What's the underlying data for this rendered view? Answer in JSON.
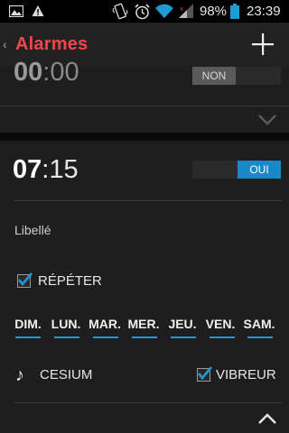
{
  "status_bar": {
    "battery_percent": "98%",
    "time": "23:39",
    "icons": [
      "image-icon",
      "warning-icon",
      "vibrate-icon",
      "alarm-clock-icon",
      "wifi-icon",
      "cell-signal-icon",
      "battery-icon"
    ]
  },
  "action_bar": {
    "title": "Alarmes",
    "add_icon": "plus-icon",
    "title_color": "#f4454c"
  },
  "alarm_1": {
    "hours": "00",
    "minutes": "00",
    "toggle_off_label": "NON",
    "enabled": false
  },
  "alarm_2": {
    "hours": "07",
    "minutes": "15",
    "toggle_on_label": "OUI",
    "enabled": true,
    "label_placeholder": "Libellé",
    "repeat_label": "RÉPÉTER",
    "repeat_checked": true,
    "days": [
      "DIM.",
      "LUN.",
      "MAR.",
      "MER.",
      "JEU.",
      "VEN.",
      "SAM."
    ],
    "ringtone": "CESIUM",
    "vibrate_label": "VIBREUR",
    "vibrate_checked": true
  },
  "colors": {
    "accent": "#1e9bd7",
    "toggle_on": "#1689c8"
  }
}
